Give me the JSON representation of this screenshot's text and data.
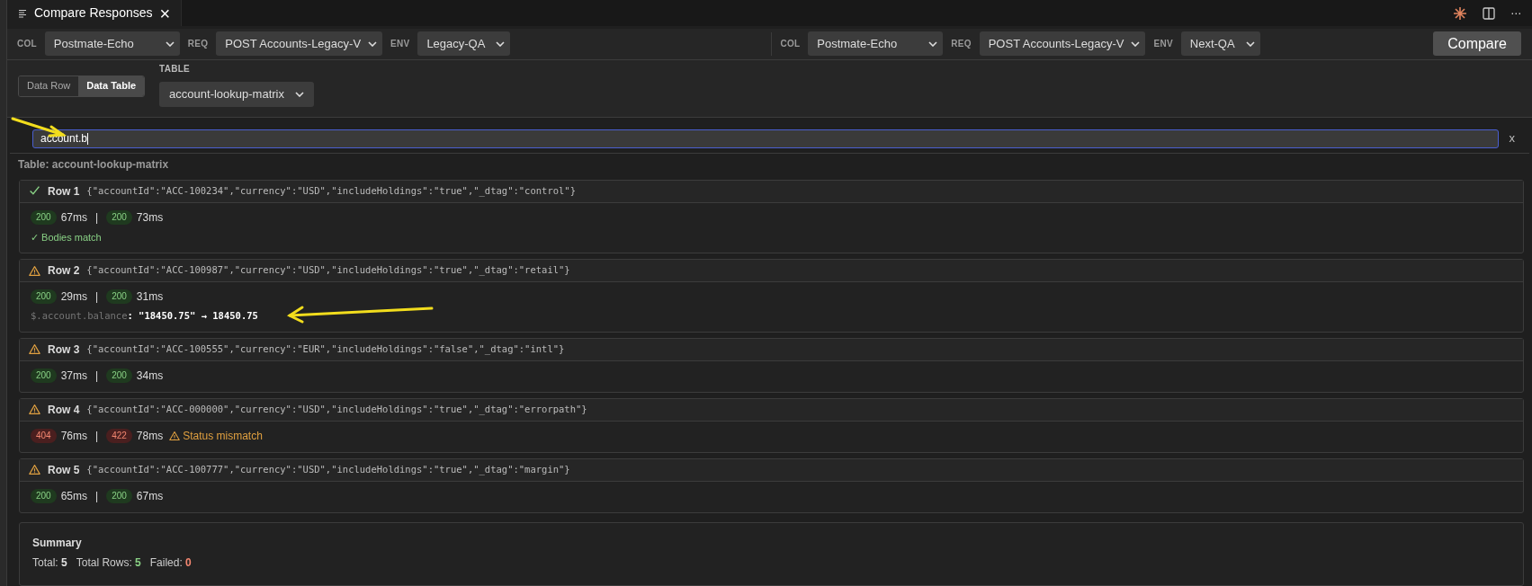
{
  "tab": {
    "title": "Compare Responses",
    "close": "×"
  },
  "header_actions": {
    "more": "···"
  },
  "left": {
    "col_label": "COL",
    "collection": "Postmate-Echo",
    "req_label": "REQ",
    "request": "POST Accounts-Legacy-V",
    "env_label": "ENV",
    "environment": "Legacy-QA"
  },
  "right": {
    "col_label": "COL",
    "collection": "Postmate-Echo",
    "req_label": "REQ",
    "request": "POST Accounts-Legacy-V",
    "env_label": "ENV",
    "environment": "Next-QA"
  },
  "compare_button": "Compare",
  "modes": [
    {
      "label": "Data Row",
      "selected": false
    },
    {
      "label": "Data Table",
      "selected": true
    }
  ],
  "table_select": {
    "label": "TABLE",
    "value": "account-lookup-matrix"
  },
  "filter": {
    "value": "account.b",
    "clear": "x"
  },
  "table_title": "Table: account-lookup-matrix",
  "rows": [
    {
      "passed": true,
      "title": "Row 1",
      "params": "{\"accountId\":\"ACC-100234\",\"currency\":\"USD\",\"includeHoldings\":\"true\",\"_dtag\":\"control\"}",
      "left": {
        "code": "200",
        "kind": "ok",
        "time": "67ms"
      },
      "sep": "|",
      "right": {
        "code": "200",
        "kind": "ok",
        "time": "73ms"
      },
      "message": {
        "kind": "match",
        "text": "✓ Bodies match"
      }
    },
    {
      "passed": false,
      "title": "Row 2",
      "params": "{\"accountId\":\"ACC-100987\",\"currency\":\"USD\",\"includeHoldings\":\"true\",\"_dtag\":\"retail\"}",
      "left": {
        "code": "200",
        "kind": "ok",
        "time": "29ms"
      },
      "sep": "|",
      "right": {
        "code": "200",
        "kind": "ok",
        "time": "31ms"
      },
      "diff": {
        "path": "$.account.balance",
        "value": ": \"18450.75\" → 18450.75"
      }
    },
    {
      "passed": false,
      "title": "Row 3",
      "params": "{\"accountId\":\"ACC-100555\",\"currency\":\"EUR\",\"includeHoldings\":\"false\",\"_dtag\":\"intl\"}",
      "left": {
        "code": "200",
        "kind": "ok",
        "time": "37ms"
      },
      "sep": "|",
      "right": {
        "code": "200",
        "kind": "ok",
        "time": "34ms"
      }
    },
    {
      "passed": false,
      "title": "Row 4",
      "params": "{\"accountId\":\"ACC-000000\",\"currency\":\"USD\",\"includeHoldings\":\"true\",\"_dtag\":\"errorpath\"}",
      "left": {
        "code": "404",
        "kind": "error",
        "time": "76ms"
      },
      "sep": "|",
      "right": {
        "code": "422",
        "kind": "error",
        "time": "78ms"
      },
      "message": {
        "kind": "mismatch",
        "text": "Status mismatch"
      }
    },
    {
      "passed": false,
      "title": "Row 5",
      "params": "{\"accountId\":\"ACC-100777\",\"currency\":\"USD\",\"includeHoldings\":\"true\",\"_dtag\":\"margin\"}",
      "left": {
        "code": "200",
        "kind": "ok",
        "time": "65ms"
      },
      "sep": "|",
      "right": {
        "code": "200",
        "kind": "ok",
        "time": "67ms"
      }
    }
  ],
  "summary": {
    "title": "Summary",
    "items": [
      {
        "label": "Total:",
        "value": "5",
        "color": "#e0e0e0"
      },
      {
        "label": "Total Rows:",
        "value": "5",
        "color": "#89d185"
      },
      {
        "label": "Failed:",
        "value": "0",
        "color": "#f48771"
      }
    ]
  }
}
